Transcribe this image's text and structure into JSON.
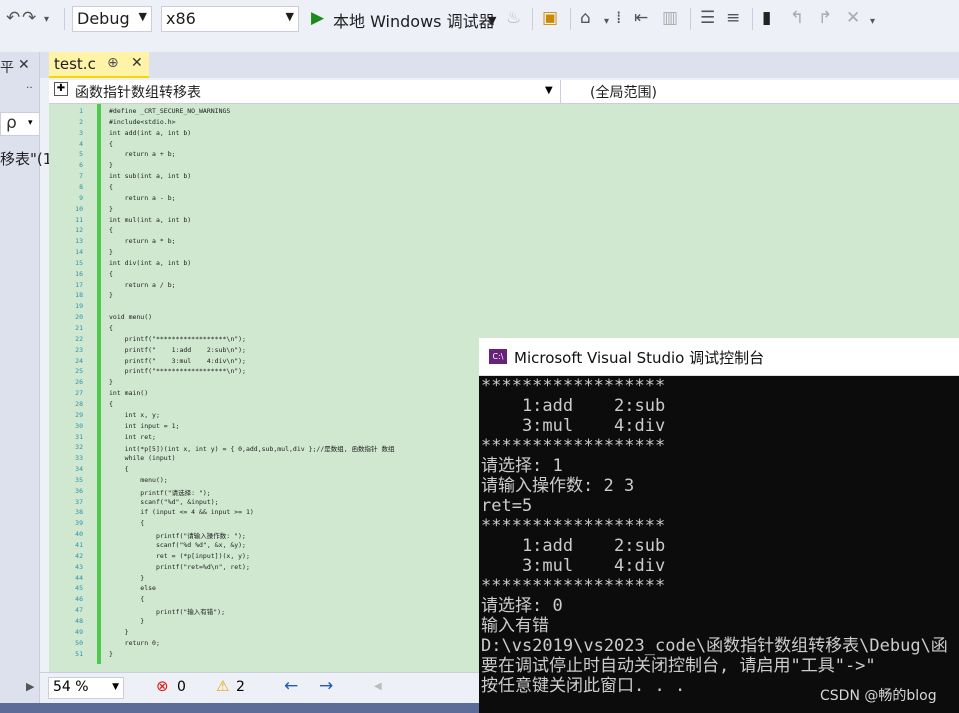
{
  "toolbar": {
    "config": "Debug",
    "platform": "x86",
    "run_label": "本地 Windows 调试器"
  },
  "left_pane": {
    "pin_glyph": "平",
    "close_glyph": "✕",
    "search_glyph": "ρ",
    "truncated_text": "移表\"(1"
  },
  "tab": {
    "name": "test.c",
    "pin": "⊕",
    "close": "✕"
  },
  "nav": {
    "function_scope": "函数指针数组转移表",
    "global_scope": "(全局范围)"
  },
  "code": {
    "line_numbers": [
      "1",
      "2",
      "3",
      "4",
      "5",
      "6",
      "7",
      "8",
      "9",
      "10",
      "11",
      "12",
      "13",
      "14",
      "15",
      "16",
      "17",
      "18",
      "19",
      "20",
      "21",
      "22",
      "23",
      "24",
      "25",
      "26",
      "27",
      "28",
      "29",
      "30",
      "31",
      "32",
      "33",
      "34",
      "35",
      "36",
      "37",
      "38",
      "39",
      "40",
      "41",
      "42",
      "43",
      "44",
      "45",
      "46",
      "47",
      "48",
      "49",
      "50",
      "51"
    ],
    "lines": [
      "#define _CRT_SECURE_NO_WARNINGS",
      "#include<stdio.h>",
      "int add(int a, int b)",
      "{",
      "    return a + b;",
      "}",
      "int sub(int a, int b)",
      "{",
      "    return a - b;",
      "}",
      "int mul(int a, int b)",
      "{",
      "    return a * b;",
      "}",
      "int div(int a, int b)",
      "{",
      "    return a / b;",
      "}",
      "",
      "void menu()",
      "{",
      "    printf(\"******************\\n\");",
      "    printf(\"    1:add    2:sub\\n\");",
      "    printf(\"    3:mul    4:div\\n\");",
      "    printf(\"******************\\n\");",
      "}",
      "int main()",
      "{",
      "    int x, y;",
      "    int input = 1;",
      "    int ret;",
      "    int(*p[5])(int x, int y) = { 0,add,sub,mul,div };//是数组, 函数指针 数组",
      "    while (input)",
      "    {",
      "        menu();",
      "        printf(\"请选择: \");",
      "        scanf(\"%d\", &input);",
      "        if (input <= 4 && input >= 1)",
      "        {",
      "            printf(\"请输入操作数: \");",
      "            scanf(\"%d %d\", &x, &y);",
      "            ret = (*p[input])(x, y);",
      "            printf(\"ret=%d\\n\", ret);",
      "        }",
      "        else",
      "        {",
      "            printf(\"输入有错\");",
      "        }",
      "    }",
      "    return 0;",
      "}"
    ]
  },
  "status": {
    "zoom": "54 %",
    "errors": "0",
    "warnings": "2"
  },
  "console": {
    "title": "Microsoft Visual Studio 调试控制台",
    "lines": [
      "******************",
      "    1:add    2:sub",
      "    3:mul    4:div",
      "******************",
      "请选择: 1",
      "请输入操作数: 2 3",
      "ret=5",
      "******************",
      "    1:add    2:sub",
      "    3:mul    4:div",
      "******************",
      "请选择: 0",
      "输入有错",
      "D:\\vs2019\\vs2023_code\\函数指针数组转移表\\Debug\\函",
      "要在调试停止时自动关闭控制台, 请启用\"工具\"->\"",
      "按任意键关闭此窗口. . ."
    ]
  },
  "watermark": "CSDN @畅的blog"
}
